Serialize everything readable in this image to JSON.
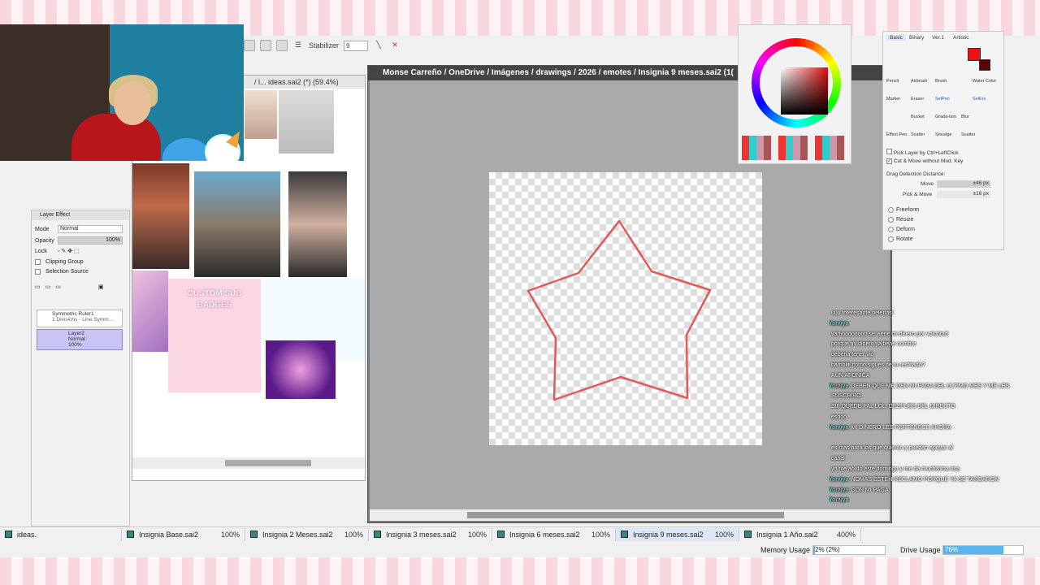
{
  "toolbar": {
    "stabilizer_label": "Stabilizer",
    "stabilizer_value": "9"
  },
  "reference_window": {
    "title": "ideas.sai2 (*) (59.4%)",
    "title_prefix": "/ l...",
    "badge_banner": "CUSTOM SUB BADGES"
  },
  "layer_effect": {
    "title": "Layer Effect",
    "mode_label": "Mode",
    "mode_value": "Normal",
    "opacity_label": "Opacity",
    "opacity_value": "100%",
    "lock_label": "Lock",
    "clipping_group": "Clipping Group",
    "selection_source": "Selection Source",
    "layers": [
      {
        "name": "Symmetric Ruler1",
        "detail": "1 Divisions - Line Symm..."
      },
      {
        "name": "Layer2",
        "mode": "Normal",
        "opacity": "100%"
      }
    ]
  },
  "canvas_window": {
    "title": "Monse Carreño / OneDrive / Imágenes / drawings / 2026 / emotes / Insignia 9 meses.sai2 (1("
  },
  "tool_panel": {
    "tabs": [
      "Basic",
      "Binary",
      "Ver.1",
      "Artistic"
    ],
    "tools": [
      "Pencil",
      "Airbrush",
      "Brush",
      "Water Color",
      "Marker",
      "Eraser",
      "SelPen",
      "SelErs",
      "Bucket",
      "Grada-tion",
      "Blur",
      "Effect Pen",
      "Scatter",
      "Smudge",
      "Scatter"
    ],
    "pick_layer": "Pick Layer by Ctrl+LeftClick",
    "cut_move": "Cut & Move without Mod. Key",
    "drag_detection": "Drag Detection Distance:",
    "move_label": "Move",
    "move_value": "±46 px",
    "pick_move_label": "Pick & Move",
    "pick_move_value": "±16 px",
    "radios": [
      "Freeform",
      "Resize",
      "Deform",
      "Rotate"
    ]
  },
  "chat": [
    {
      "user": "",
      "text": "uuu interesante pelerias!",
      "color": "#c080ff"
    },
    {
      "user": "Yomiya",
      "text": "",
      "color": "#5fd3c8"
    },
    {
      "user": "",
      "text": "vamoooooooo se viene mi dinero por voluntad",
      "color": "#c080ff"
    },
    {
      "user": "",
      "text": "porque mi dinero ya tiene nombre",
      "color": "#c080ff"
    },
    {
      "user": "",
      "text": "deberia tener vip",
      "color": "#f06aa0"
    },
    {
      "user": "",
      "text": "bambiiii como sigues de tu resfriado?",
      "color": "#c080ff"
    },
    {
      "user": "",
      "text": "AUN AFONICA",
      "color": "#f06aa0"
    },
    {
      "user": "Yomiya",
      "text": "DEBEN QUE ME DEN MI PAGA DEL ULTIMO MES Y ME LES",
      "color": "#5fd3c8"
    },
    {
      "user": "",
      "text": "SUSCRIBO",
      "color": "#fff"
    },
    {
      "user": "",
      "text": "SIII QUEDE PAL LOL! DESPUES DEL DIRECTO",
      "color": "#f06aa0"
    },
    {
      "user": "",
      "text": "esooo",
      "color": "#c080ff"
    },
    {
      "user": "Yomiya",
      "text": "MI DINERO LES PERTENECE AHORA",
      "color": "#5fd3c8"
    },
    {
      "user": "",
      "text": "",
      "color": "#f06aa0"
    },
    {
      "user": "",
      "text": "es más para los que quieran y puedan apoyar al",
      "color": "#f06aa0"
    },
    {
      "user": "",
      "text": "canal",
      "color": "#fff"
    },
    {
      "user": "",
      "text": "yo me aouto este domingo y me da muchisima risa",
      "color": "#c080ff"
    },
    {
      "user": "Yomiya",
      "text": "NOMAS ESTEN RECLAMO PORQUE YA SE TARDARON",
      "color": "#5fd3c8"
    },
    {
      "user": "Yomiya",
      "text": "CON MI PAGA",
      "color": "#5fd3c8"
    },
    {
      "user": "Yomiya",
      "text": "",
      "color": "#5fd3c8"
    }
  ],
  "file_tabs": [
    {
      "name": "ideas.",
      "pct": ""
    },
    {
      "name": "Insignia Base.sai2",
      "pct": "100%"
    },
    {
      "name": "Insignia 2 Meses.sai2",
      "pct": "100%"
    },
    {
      "name": "Insignia 3 meses.sai2",
      "pct": "100%"
    },
    {
      "name": "Insignia 6 meses.sai2",
      "pct": "100%"
    },
    {
      "name": "Insignia 9 meses.sai2",
      "pct": "100%"
    },
    {
      "name": "Insignia 1 Año.sai2",
      "pct": "400%"
    }
  ],
  "status": {
    "memory_label": "Memory Usage",
    "memory_value": "2% (2%)",
    "memory_fraction": 0.02,
    "drive_label": "Drive Usage",
    "drive_value": "76%",
    "drive_fraction": 0.76
  },
  "colors": {
    "current_color": "#ee1111",
    "stroke": "#e05a5a",
    "accent_selection": "#5ab4ee"
  }
}
